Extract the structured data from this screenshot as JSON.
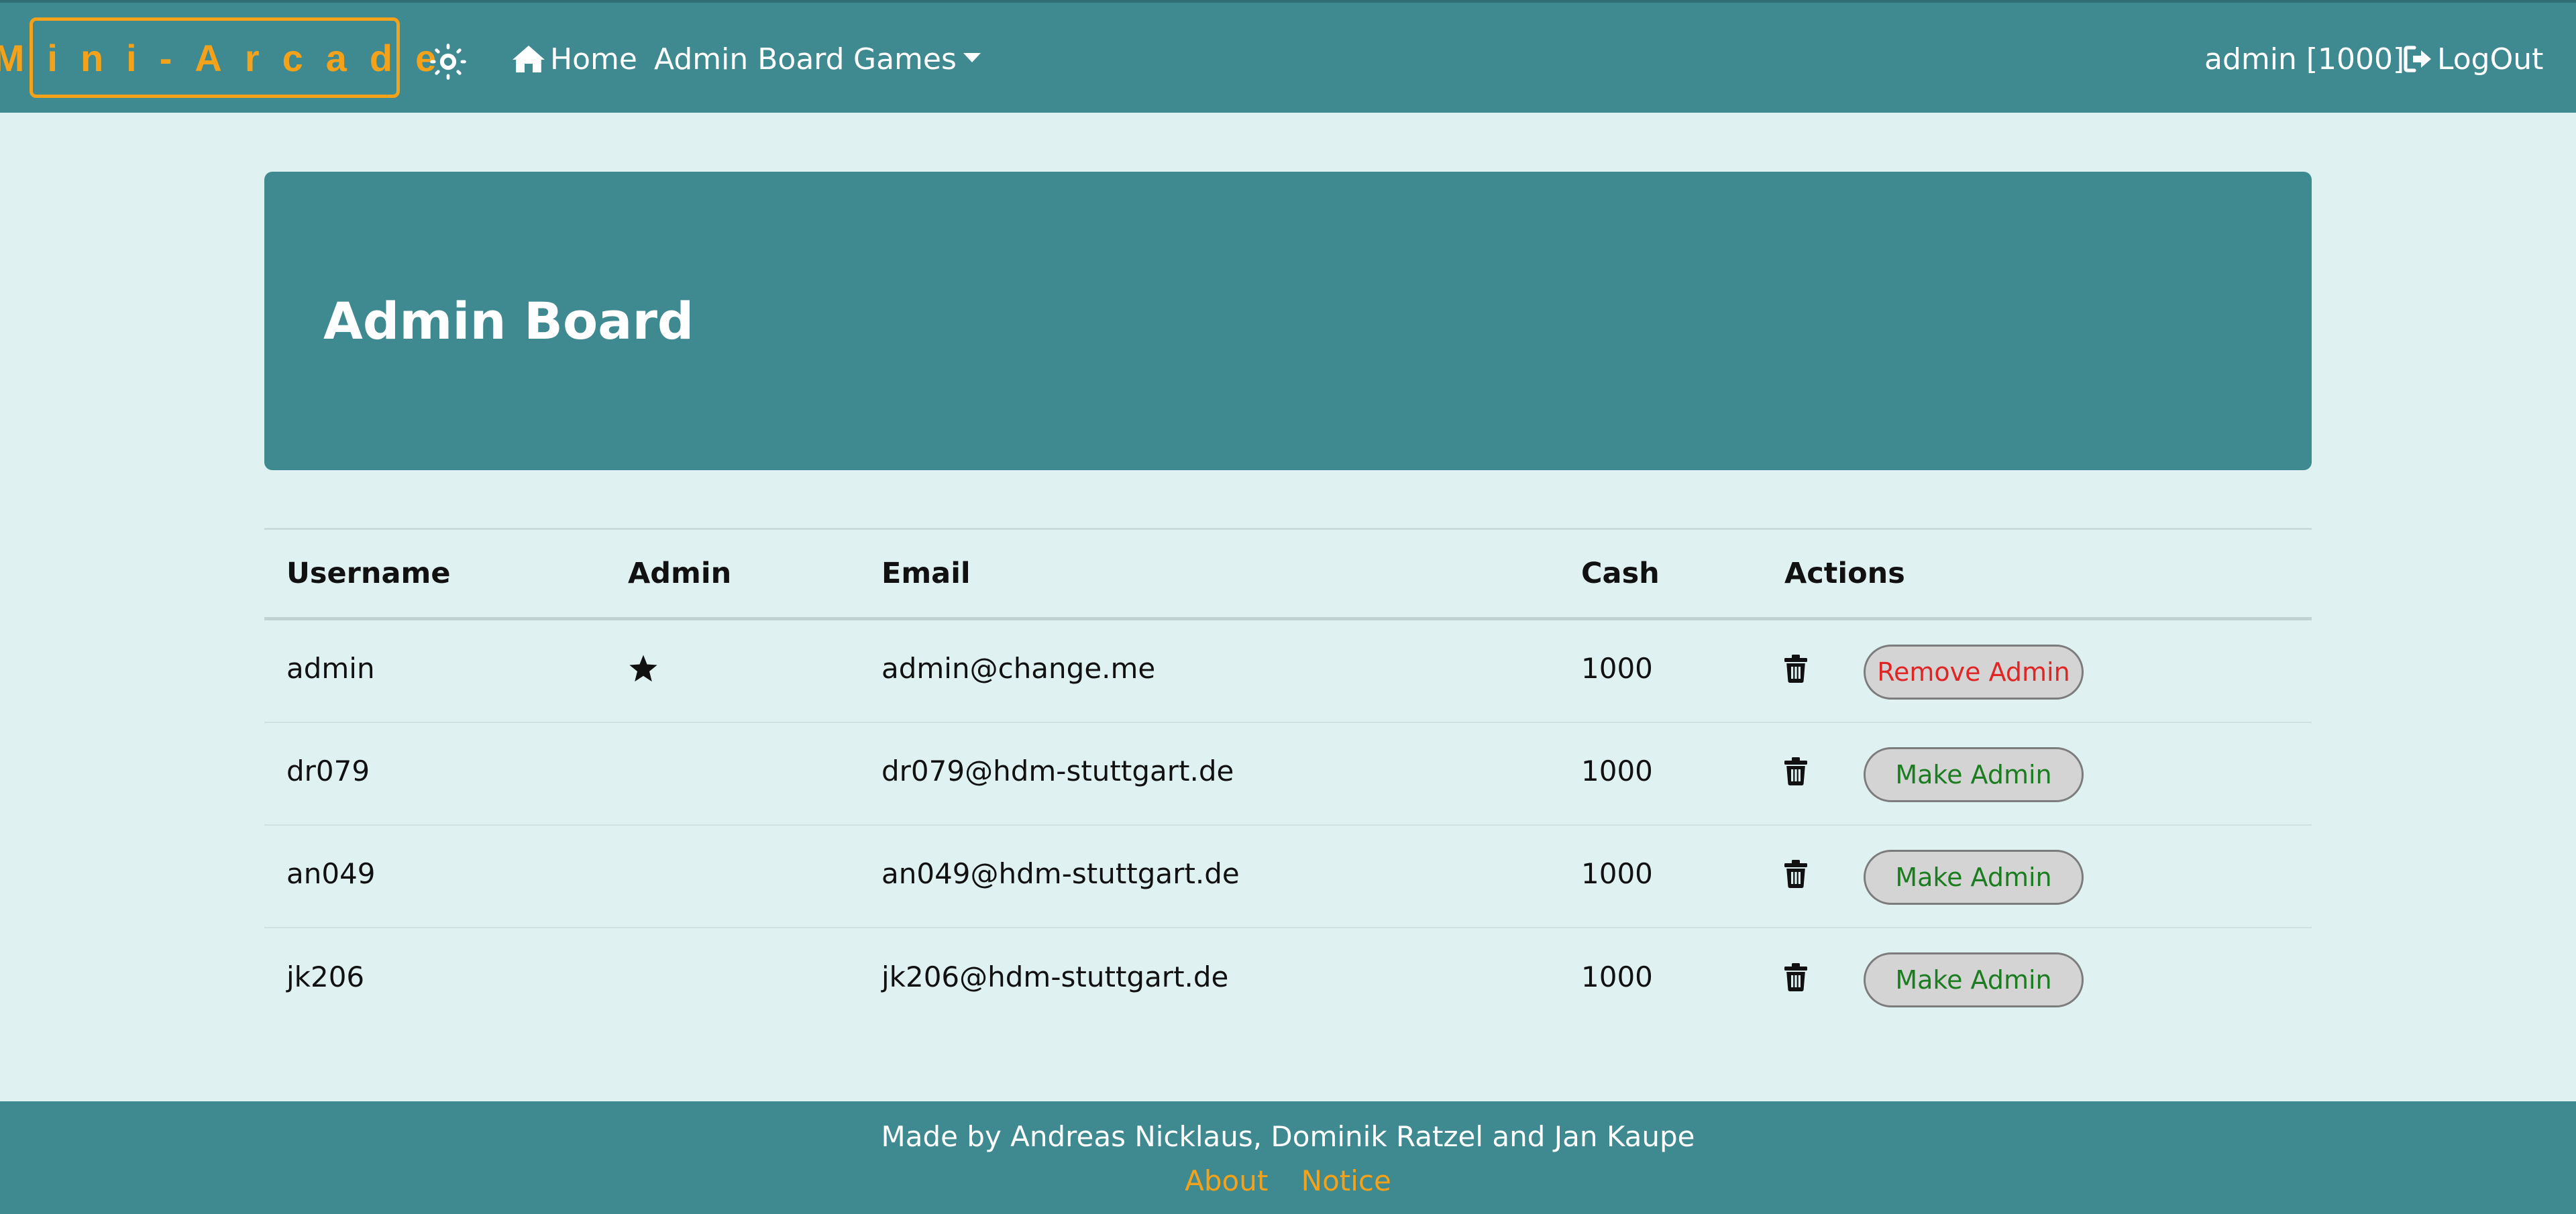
{
  "navbar": {
    "brand": "Mini-Arcade",
    "theme_icon": "sun-icon",
    "home_label": "Home",
    "home_icon": "home-icon",
    "admin_board_label": "Admin Board",
    "games_label": "Games",
    "user_label": "admin [1000]",
    "logout_label": "LogOut",
    "logout_icon": "logout-icon"
  },
  "jumbotron": {
    "title": "Admin Board"
  },
  "table": {
    "headers": {
      "username": "Username",
      "admin": "Admin",
      "email": "Email",
      "cash": "Cash",
      "actions": "Actions"
    },
    "rows": [
      {
        "username": "admin",
        "is_admin": true,
        "email": "admin@change.me",
        "cash": "1000",
        "action_label": "Remove Admin"
      },
      {
        "username": "dr079",
        "is_admin": false,
        "email": "dr079@hdm-stuttgart.de",
        "cash": "1000",
        "action_label": "Make Admin"
      },
      {
        "username": "an049",
        "is_admin": false,
        "email": "an049@hdm-stuttgart.de",
        "cash": "1000",
        "action_label": "Make Admin"
      },
      {
        "username": "jk206",
        "is_admin": false,
        "email": "jk206@hdm-stuttgart.de",
        "cash": "1000",
        "action_label": "Make Admin"
      }
    ]
  },
  "footer": {
    "credits": "Made by Andreas Nicklaus, Dominik Ratzel and Jan Kaupe",
    "about_label": "About",
    "notice_label": "Notice"
  },
  "colors": {
    "primary": "#3f8990",
    "background": "#dff2f1",
    "accent": "#f5a21b",
    "remove": "#e02525",
    "make": "#1b7d1f"
  }
}
